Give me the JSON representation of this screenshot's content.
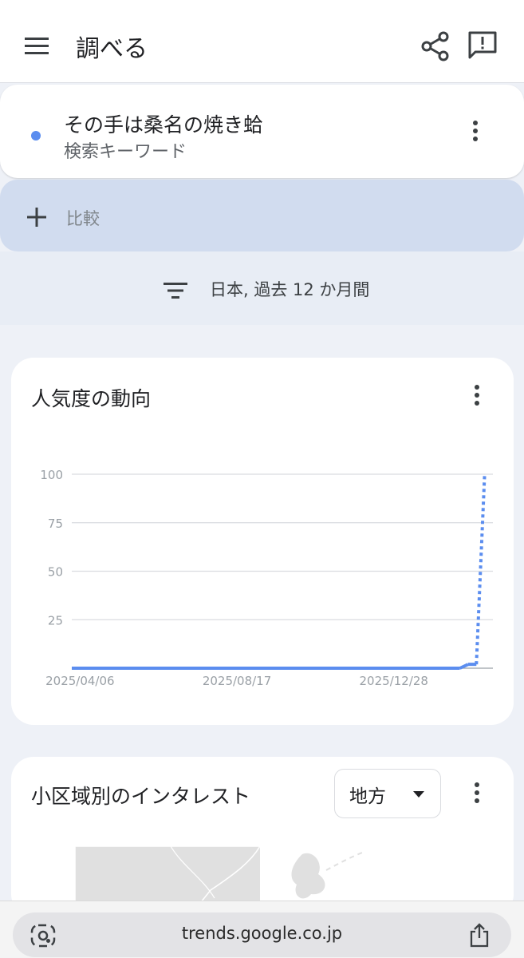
{
  "header": {
    "title": "調べる"
  },
  "term": {
    "keyword": "その手は桑名の焼き蛤",
    "type_label": "検索キーワード",
    "dot_color": "#5b8def"
  },
  "compare": {
    "label": "比較"
  },
  "filter": {
    "text": "日本, 過去 12 か月間"
  },
  "interest_card": {
    "title": "人気度の動向"
  },
  "chart_data": {
    "type": "line",
    "title": "人気度の動向",
    "xlabel": "",
    "ylabel": "",
    "ylim": [
      0,
      100
    ],
    "y_ticks": [
      "100",
      "75",
      "50",
      "25"
    ],
    "x_ticks": [
      "2025/04/06",
      "2025/08/17",
      "2025/12/28"
    ],
    "x_range": [
      "2025/03/30",
      "2026/03/22"
    ],
    "grid": true,
    "series": [
      {
        "color": "#5b8def",
        "points": [
          {
            "x": "2025/03/30",
            "y": 0,
            "style": "solid"
          },
          {
            "x": "2026/02/22",
            "y": 0,
            "style": "solid"
          },
          {
            "x": "2026/03/01",
            "y": 2,
            "style": "solid"
          },
          {
            "x": "2026/03/08",
            "y": 2,
            "style": "solid"
          },
          {
            "x": "2026/03/15",
            "y": 100,
            "style": "dotted"
          }
        ]
      }
    ]
  },
  "region_card": {
    "title": "小区域別のインタレスト",
    "dropdown_value": "地方"
  },
  "browser": {
    "url": "trends.google.co.jp"
  }
}
